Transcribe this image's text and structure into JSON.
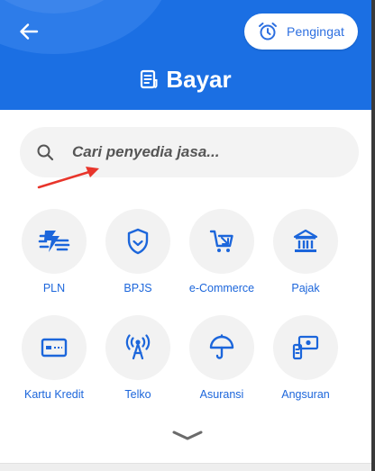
{
  "header": {
    "title": "Bayar",
    "reminder_label": "Pengingat",
    "back_icon": "arrow-left-icon",
    "title_icon": "receipt-icon",
    "reminder_icon": "alarm-clock-icon",
    "background_color": "#1b6fe3"
  },
  "search": {
    "placeholder": "Cari penyedia jasa...",
    "icon": "search-icon"
  },
  "categories": [
    {
      "label": "PLN",
      "icon": "electricity-icon"
    },
    {
      "label": "BPJS",
      "icon": "shield-icon"
    },
    {
      "label": "e-Commerce",
      "icon": "shopping-cart-icon"
    },
    {
      "label": "Pajak",
      "icon": "government-building-icon"
    },
    {
      "label": "Kartu Kredit",
      "icon": "credit-card-icon"
    },
    {
      "label": "Telko",
      "icon": "broadcast-tower-icon"
    },
    {
      "label": "Asuransi",
      "icon": "umbrella-icon"
    },
    {
      "label": "Angsuran",
      "icon": "installment-icon"
    }
  ],
  "expand_icon": "chevron-down-icon",
  "annotation_icon": "red-arrow-icon",
  "colors": {
    "accent": "#1c66db",
    "annotation": "#e8352b"
  }
}
